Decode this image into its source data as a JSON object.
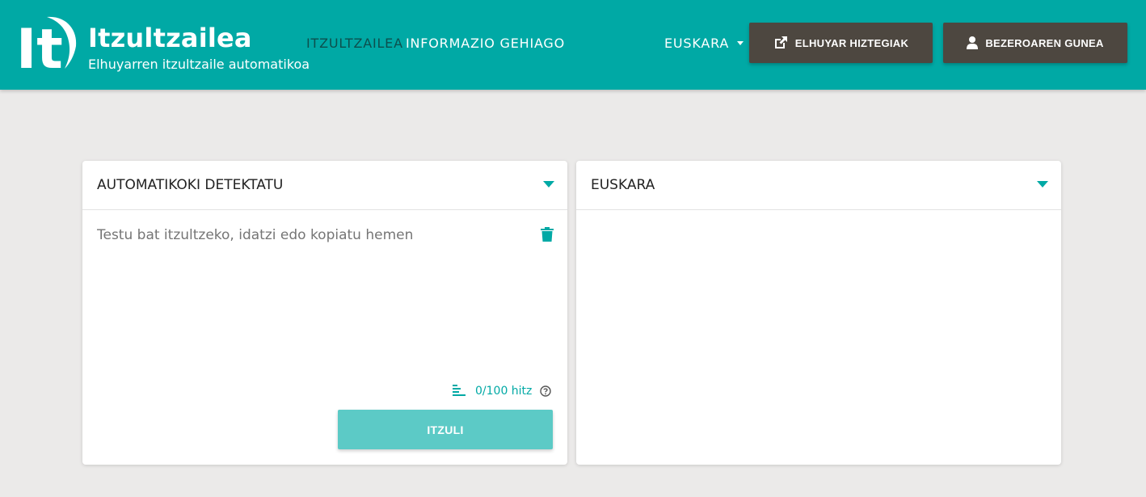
{
  "header": {
    "logo_text": "It",
    "title": "Itzultzailea",
    "subtitle": "Elhuyarren itzultzaile automatikoa",
    "nav": [
      {
        "label": "ITZULTZAILEA",
        "active": true
      },
      {
        "label": "INFORMAZIO GEHIAGO",
        "active": false
      }
    ],
    "language": "EUSKARA",
    "buttons": {
      "dictionaries": "ELHUYAR HIZTEGIAK",
      "client_area": "BEZEROAREN GUNEA"
    }
  },
  "source_panel": {
    "language": "AUTOMATIKOKI DETEKTATU",
    "placeholder": "Testu bat itzultzeko, idatzi edo kopiatu hemen",
    "value": "",
    "word_count": "0/100 hitz",
    "translate_label": "ITZULI"
  },
  "target_panel": {
    "language": "EUSKARA",
    "output": ""
  },
  "colors": {
    "brand": "#00a9a5",
    "dark_button": "#4d4740",
    "translate_button": "#5ccac6",
    "background": "#ebeae9"
  },
  "icons": [
    "external-link-icon",
    "user-icon",
    "trash-icon",
    "text-align-icon",
    "help-icon",
    "chevron-down-icon"
  ]
}
